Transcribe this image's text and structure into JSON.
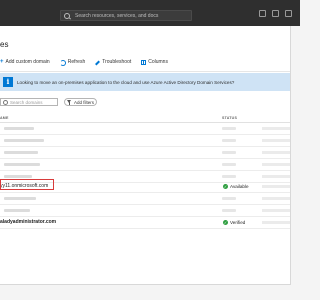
{
  "topbar": {
    "search_placeholder": "Search resources, services, and docs"
  },
  "page": {
    "title": "es"
  },
  "toolbar": {
    "add_label": "Add custom domain",
    "refresh_label": "Refresh",
    "troubleshoot_label": "Troubleshoot",
    "columns_label": "Columns"
  },
  "banner": {
    "text": "Looking to move an on-premises application to the cloud and use Azure Active Directory Domain Services?"
  },
  "filters": {
    "search_placeholder": "Search domains",
    "add_filters_label": "Add filters"
  },
  "table": {
    "headers": {
      "name": "AME",
      "status": "STATUS"
    },
    "rows": [
      {
        "domain": "yy11.onmicrosoft.com",
        "status": "Available"
      },
      {
        "domain": "aladyadministrator.com",
        "status": "Verified"
      }
    ]
  },
  "colors": {
    "accent": "#0078d4",
    "verified": "#2e9e3f",
    "highlight": "#d83b3b",
    "banner": "#cfe3f5"
  }
}
